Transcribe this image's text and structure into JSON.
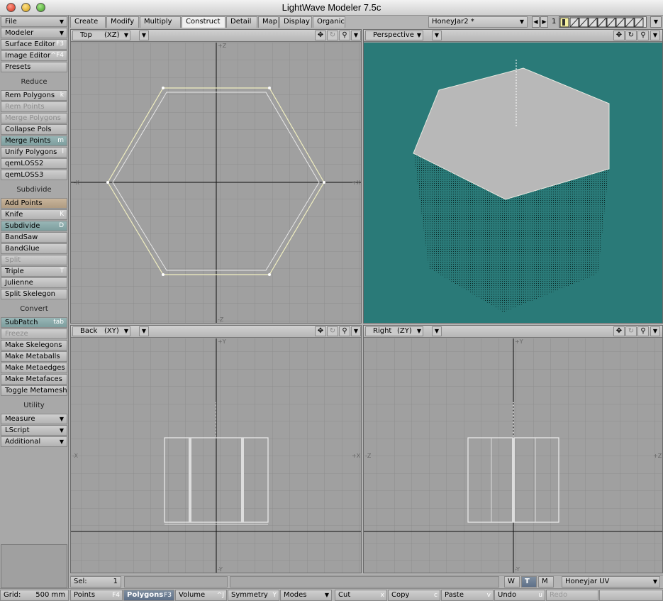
{
  "window": {
    "title": "LightWave Modeler 7.5c"
  },
  "sidebar": {
    "menus": [
      {
        "label": "File"
      },
      {
        "label": "Modeler"
      }
    ],
    "top": [
      {
        "label": "Surface Editor",
        "key": "F3"
      },
      {
        "label": "Image Editor",
        "key": "^F4"
      },
      {
        "label": "Presets",
        "key": ""
      }
    ],
    "reduce": {
      "header": "Reduce",
      "items": [
        {
          "label": "Rem Polygons",
          "key": "k"
        },
        {
          "label": "Rem Points",
          "key": ""
        },
        {
          "label": "Merge Polygons",
          "key": ""
        },
        {
          "label": "Collapse Pols",
          "key": ""
        },
        {
          "label": "Merge Points",
          "key": "m"
        },
        {
          "label": "Unify Polygons",
          "key": "l"
        },
        {
          "label": "qemLOSS2",
          "key": ""
        },
        {
          "label": "qemLOSS3",
          "key": ""
        }
      ]
    },
    "subdivide": {
      "header": "Subdivide",
      "items": [
        {
          "label": "Add Points",
          "key": ""
        },
        {
          "label": "Knife",
          "key": "K"
        },
        {
          "label": "Subdivide",
          "key": "D"
        },
        {
          "label": "BandSaw",
          "key": ""
        },
        {
          "label": "BandGlue",
          "key": ""
        },
        {
          "label": "Split",
          "key": ""
        },
        {
          "label": "Triple",
          "key": "T"
        },
        {
          "label": "Julienne",
          "key": ""
        },
        {
          "label": "Split Skelegon",
          "key": ""
        }
      ]
    },
    "convert": {
      "header": "Convert",
      "items": [
        {
          "label": "SubPatch",
          "key": "tab"
        },
        {
          "label": "Freeze",
          "key": ""
        },
        {
          "label": "Make Skelegons",
          "key": ""
        },
        {
          "label": "Make Metaballs",
          "key": ""
        },
        {
          "label": "Make Metaedges",
          "key": ""
        },
        {
          "label": "Make Metafaces",
          "key": ""
        },
        {
          "label": "Toggle Metamesh",
          "key": ""
        }
      ]
    },
    "utility": {
      "header": "Utility",
      "items": [
        {
          "label": "Measure"
        },
        {
          "label": "LScript"
        },
        {
          "label": "Additional"
        }
      ]
    }
  },
  "tabs": [
    {
      "label": "Create"
    },
    {
      "label": "Modify"
    },
    {
      "label": "Multiply"
    },
    {
      "label": "Construct"
    },
    {
      "label": "Detail"
    },
    {
      "label": "Map"
    },
    {
      "label": "Display"
    },
    {
      "label": "Organic"
    }
  ],
  "object": {
    "name": "HoneyJar2 *",
    "layer_num": "1"
  },
  "viewports": {
    "top": {
      "name": "Top",
      "axis": "(XZ)",
      "labels": {
        "top": "+Z",
        "bottom": "-Z",
        "left": "-X",
        "right": "+X"
      }
    },
    "persp": {
      "name": "Perspective",
      "bg": "#2a7a78"
    },
    "back": {
      "name": "Back",
      "axis": "(XY)",
      "labels": {
        "top": "+Y",
        "bottom": "-Y",
        "left": "-X",
        "right": "+X"
      }
    },
    "right": {
      "name": "Right",
      "axis": "(ZY)",
      "labels": {
        "top": "+Y",
        "bottom": "-Y",
        "left": "-Z",
        "right": "+Z"
      }
    }
  },
  "status": {
    "sel_label": "Sel:",
    "sel_value": "1",
    "w": "W",
    "t": "T",
    "m": "M",
    "uvmap": "Honeyjar UV"
  },
  "bottom": {
    "grid_label": "Grid:",
    "grid_value": "500 mm",
    "points": "Points",
    "points_key": "F4",
    "polygons": "Polygons",
    "polygons_key": "F3",
    "volume": "Volume",
    "volume_key": "^J",
    "symmetry": "Symmetry",
    "symmetry_key": "Y",
    "modes": "Modes",
    "cut": "Cut",
    "cut_key": "x",
    "copy": "Copy",
    "copy_key": "c",
    "paste": "Paste",
    "paste_key": "v",
    "undo": "Undo",
    "undo_key": "u",
    "redo": "Redo"
  }
}
